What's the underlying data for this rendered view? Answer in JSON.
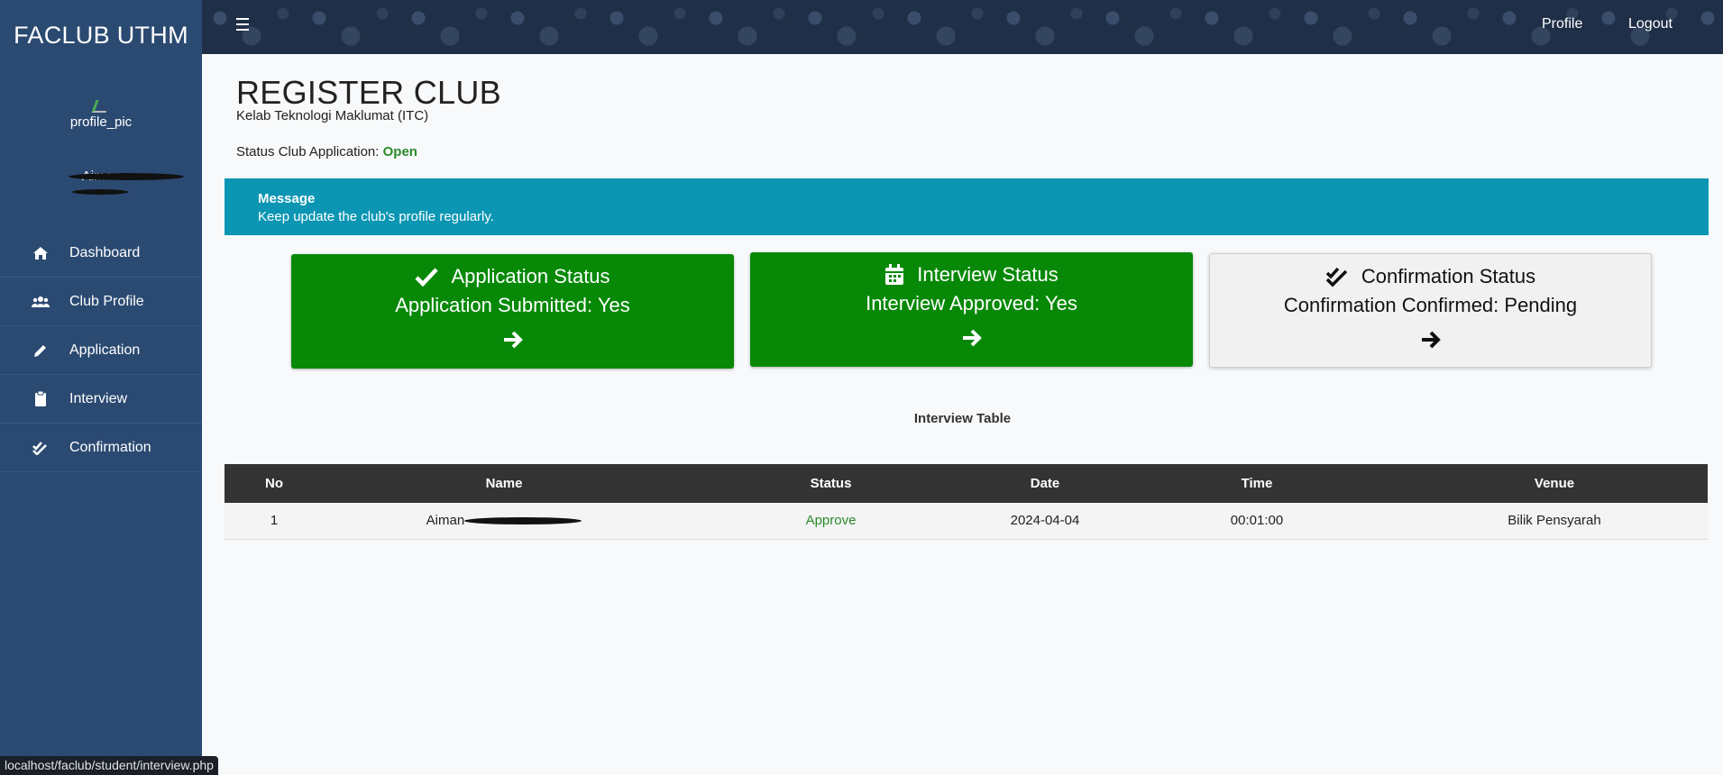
{
  "app": {
    "brand": "FACLUB UTHM"
  },
  "sidebar": {
    "profile_pic_alt": "profile_pic",
    "user_name_line1": "Aiman",
    "user_name_line2": "",
    "items": [
      {
        "label": "Dashboard",
        "icon": "home-icon"
      },
      {
        "label": "Club Profile",
        "icon": "users-icon"
      },
      {
        "label": "Application",
        "icon": "pencil-icon"
      },
      {
        "label": "Interview",
        "icon": "clipboard-icon"
      },
      {
        "label": "Confirmation",
        "icon": "double-check-icon"
      }
    ]
  },
  "topbar": {
    "profile_label": "Profile",
    "logout_label": "Logout"
  },
  "page": {
    "title": "REGISTER CLUB",
    "subtitle": "Kelab Teknologi Maklumat (ITC)",
    "status_label": "Status Club Application:",
    "status_value": "Open"
  },
  "message": {
    "title": "Message",
    "text": "Keep update the club's profile regularly."
  },
  "cards": [
    {
      "title": "Application Status",
      "value": "Application Submitted: Yes",
      "icon": "check-icon",
      "style": "green"
    },
    {
      "title": "Interview Status",
      "value": "Interview Approved: Yes",
      "icon": "calendar-icon",
      "style": "green"
    },
    {
      "title": "Confirmation Status",
      "value": "Confirmation Confirmed: Pending",
      "icon": "double-check-icon",
      "style": "gray"
    }
  ],
  "interview_table": {
    "caption": "Interview Table",
    "columns": [
      "No",
      "Name",
      "Status",
      "Date",
      "Time",
      "Venue"
    ],
    "rows": [
      {
        "no": "1",
        "name": "Aiman",
        "status": "Approve",
        "date": "2024-04-04",
        "time": "00:01:00",
        "venue": "Bilik Pensyarah"
      }
    ]
  },
  "statusbar": {
    "url": "localhost/faclub/student/interview.php"
  },
  "colors": {
    "sidebar": "#2b4a72",
    "accent": "#0c96b3",
    "success": "#078907"
  }
}
